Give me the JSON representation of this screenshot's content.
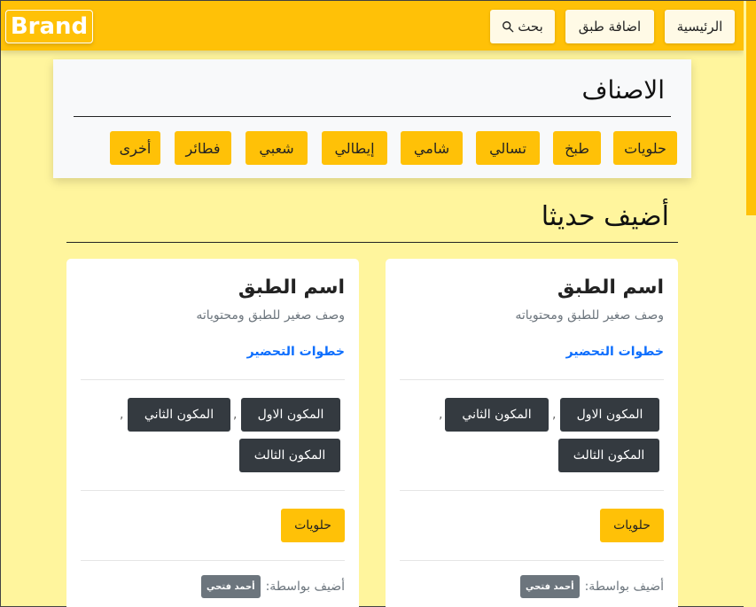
{
  "navbar": {
    "brand": "Brand",
    "home_label": "الرئيسية",
    "add_dish_label": "اضافة طبق",
    "search_label": "بحث"
  },
  "categories": {
    "title": "الاصناف",
    "items": [
      "حلويات",
      "طبخ",
      "تسالي",
      "شامي",
      "إيطالي",
      "شعبي",
      "فطائر",
      "أخرى"
    ]
  },
  "recent": {
    "title": "أضيف حديثا"
  },
  "cards": [
    {
      "title": "اسم الطبق",
      "description": "وصف صغير للطبق ومحتوياته",
      "link": "خطوات التحضير",
      "ingredients": [
        "المكون الاول",
        "المكون الثاني",
        "المكون الثالث"
      ],
      "separator": ",",
      "category": "حلويات",
      "author_label": "أضيف بواسطة:",
      "author": "أحمد فتحي"
    },
    {
      "title": "اسم الطبق",
      "description": "وصف صغير للطبق ومحتوياته",
      "link": "خطوات التحضير",
      "ingredients": [
        "المكون الاول",
        "المكون الثاني",
        "المكون الثالث"
      ],
      "separator": ",",
      "category": "حلويات",
      "author_label": "أضيف بواسطة:",
      "author": "أحمد فتحي"
    }
  ],
  "colors": {
    "accent": "#ffc107",
    "background": "#fff59d",
    "dark_badge": "#343a40"
  }
}
